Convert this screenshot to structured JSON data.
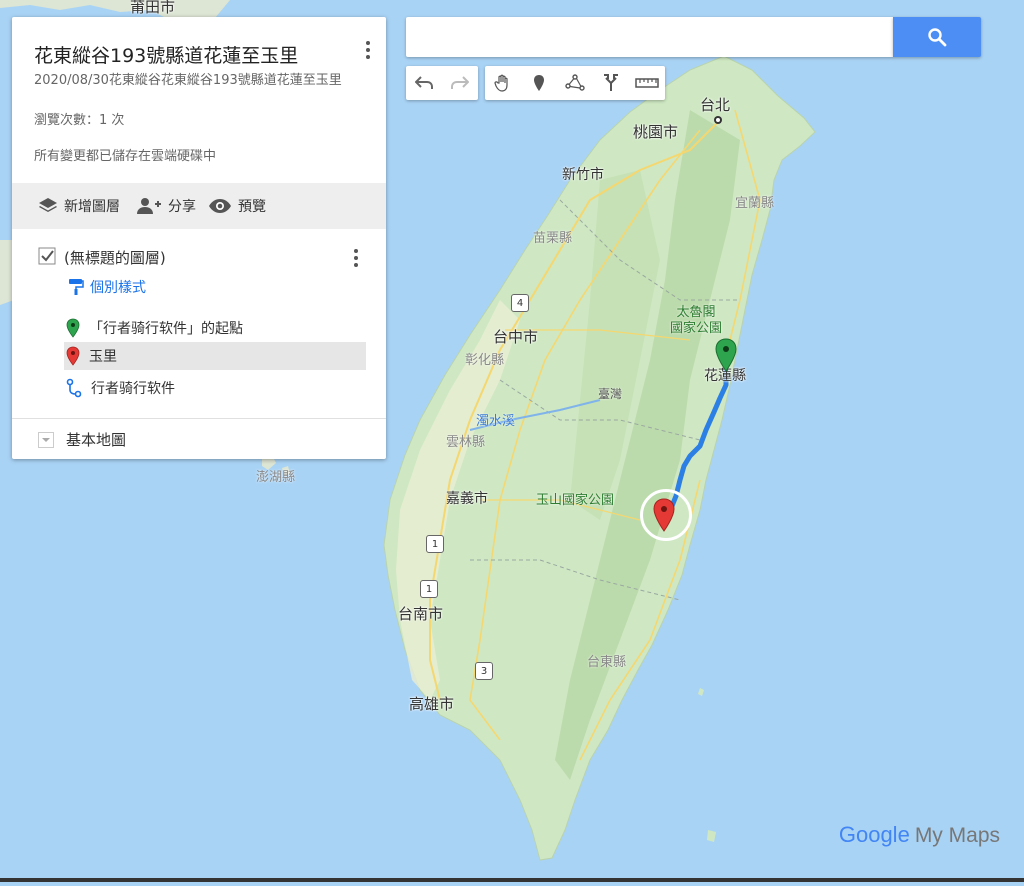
{
  "panel": {
    "title": "花東縱谷193號縣道花蓮至玉里",
    "description": "2020/08/30花東縱谷花東縱谷193號縣道花蓮至玉里",
    "views": "瀏覽次數：1 次",
    "saved": "所有變更都已儲存在雲端硬碟中",
    "toolbar": {
      "add_layer": "新增圖層",
      "share": "分享",
      "preview": "預覽"
    },
    "layer": {
      "name": "(無標題的圖層)",
      "checked": true,
      "style_link": "個別樣式",
      "items": [
        {
          "label": "「行者骑行软件」的起點",
          "icon": "green-pin-icon",
          "color": "#2ea44f"
        },
        {
          "label": "玉里",
          "icon": "red-pin-icon",
          "color": "#d93025",
          "selected": true
        },
        {
          "label": "行者骑行软件",
          "icon": "route-icon",
          "color": "#1a73e8"
        }
      ]
    },
    "basemap": "基本地圖"
  },
  "search": {
    "placeholder": ""
  },
  "map": {
    "labels": {
      "taipei": "台北",
      "taoyuan": "桃園市",
      "hsinchu": "新竹市",
      "yilan": "宜蘭縣",
      "miaoli": "苗栗縣",
      "taichung": "台中市",
      "changhua": "彰化縣",
      "taroko": "太魯閣\n國家公園",
      "hualien": "花蓮縣",
      "taiwan": "臺灣",
      "zhuoshui": "濁水溪",
      "yunlin": "雲林縣",
      "penghu": "澎湖縣",
      "chiayi": "嘉義市",
      "yushan": "玉山國家公園",
      "tainan": "台南市",
      "taitung": "台東縣",
      "kaohsiung": "高雄市",
      "putian": "莆田市"
    },
    "route_shields": [
      "4",
      "1",
      "1",
      "3"
    ],
    "land_color": "#cfe8c3",
    "water_color": "#a9d3f5",
    "route_color": "#1a73e8"
  },
  "branding": {
    "google": "Google",
    "my_maps": "My Maps"
  }
}
